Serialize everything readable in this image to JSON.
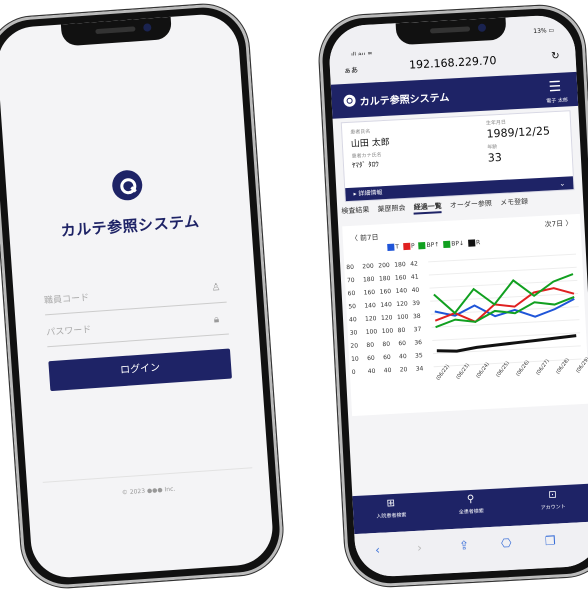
{
  "login": {
    "app_title": "カルテ参照システム",
    "staff_code_placeholder": "職員コード",
    "password_placeholder": "パスワード",
    "login_button": "ログイン",
    "copyright": "© 2023 ●●● Inc."
  },
  "status_bar": {
    "time": "19:46",
    "signal": "au",
    "battery": "13%"
  },
  "url_bar": {
    "aa": "ぁあ",
    "url": "192.168.229.70",
    "reload_icon": "reload-icon"
  },
  "app_bar": {
    "title": "カルテ参照システム",
    "user": "電子 太郎",
    "menu_icon": "hamburger-icon"
  },
  "patient": {
    "name_label": "患者氏名",
    "name": "山田 太郎",
    "kana_label": "患者カナ氏名",
    "kana": "ﾔﾏﾀﾞ ﾀﾛｳ",
    "dob_label": "生年月日",
    "dob": "1989/12/25",
    "age_label": "年齢",
    "age": "33",
    "detail_label": "▸ 詳細情報"
  },
  "tabs": [
    "検査結果",
    "薬歴照会",
    "経過一覧",
    "オーダー参照",
    "メモ登録"
  ],
  "tab_active_index": 2,
  "chart_nav": {
    "prev": "〈 前7日",
    "next": "次7日 〉"
  },
  "chart_data": {
    "type": "line",
    "legend": [
      "T",
      "P",
      "BP↑",
      "BP↓",
      "R"
    ],
    "colors": [
      "#1f55d8",
      "#e02020",
      "#11a020",
      "#11a020",
      "#111111"
    ],
    "x": [
      "06/22",
      "06/23",
      "06/24",
      "06/25",
      "06/26",
      "06/27",
      "06/28",
      "06/29"
    ],
    "y_axes": [
      [
        "80",
        "70",
        "60",
        "50",
        "40",
        "30",
        "20",
        "10",
        "0"
      ],
      [
        "200",
        "180",
        "160",
        "140",
        "120",
        "100",
        "80",
        "60",
        "40"
      ],
      [
        "200",
        "180",
        "160",
        "140",
        "120",
        "100",
        "80",
        "60",
        "40"
      ],
      [
        "180",
        "160",
        "140",
        "120",
        "100",
        "80",
        "60",
        "40",
        "20"
      ],
      [
        "42",
        "41",
        "40",
        "39",
        "38",
        "37",
        "36",
        "35",
        "34"
      ]
    ],
    "series": [
      {
        "name": "T",
        "values": [
          38.2,
          37.8,
          38.5,
          37.6,
          38.0,
          37.4,
          37.9,
          38.6
        ]
      },
      {
        "name": "P",
        "values": [
          110,
          120,
          105,
          130,
          125,
          145,
          150,
          140
        ]
      },
      {
        "name": "BP↑",
        "values": [
          150,
          120,
          155,
          130,
          165,
          140,
          160,
          170
        ]
      },
      {
        "name": "BP↓",
        "values": [
          80,
          90,
          85,
          100,
          95,
          110,
          105,
          115
        ]
      },
      {
        "name": "R",
        "values": [
          12,
          11,
          13,
          14,
          15,
          16,
          17,
          18
        ]
      }
    ]
  },
  "bottom_nav": [
    {
      "label": "入院患者検索",
      "icon": "bed-search-icon"
    },
    {
      "label": "全患者検索",
      "icon": "patients-search-icon"
    },
    {
      "label": "アカウント",
      "icon": "account-icon"
    }
  ]
}
